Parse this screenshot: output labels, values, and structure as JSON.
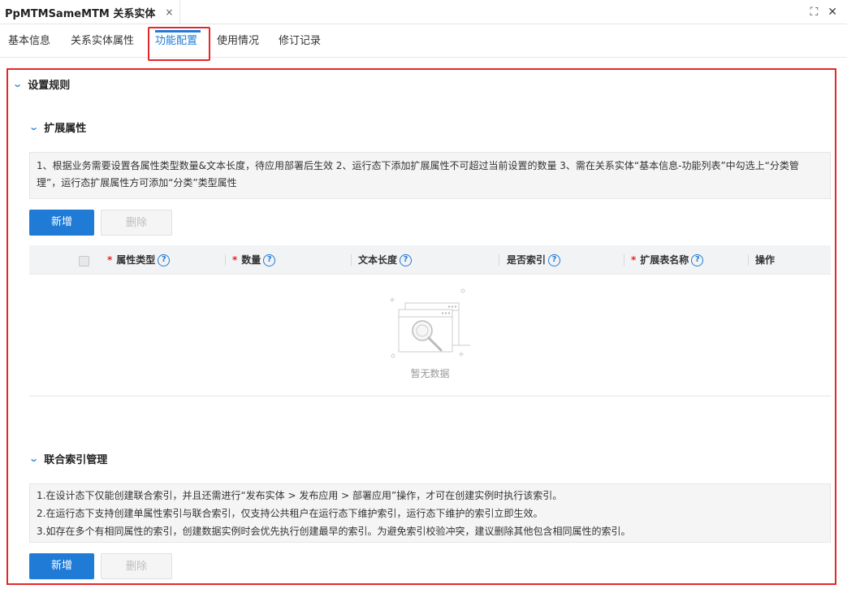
{
  "window": {
    "tab_title": "PpMTMSameMTM 关系实体",
    "close_glyph": "×",
    "expand_glyph": "⛶",
    "window_close_glyph": "✕"
  },
  "tabs": [
    {
      "label": "基本信息"
    },
    {
      "label": "关系实体属性"
    },
    {
      "label": "功能配置",
      "active": true
    },
    {
      "label": "使用情况"
    },
    {
      "label": "修订记录"
    }
  ],
  "settings": {
    "title": "设置规则",
    "extend": {
      "title": "扩展属性",
      "notice_line1": "1、根据业务需要设置各属性类型数量&文本长度，待应用部署后生效 2、运行态下添加扩展属性不可超过当前设置的数量 3、需在关系实体“基本信息-功能列表”中勾选上“分类管",
      "notice_line2": "理”，运行态扩展属性方可添加“分类”类型属性",
      "add_label": "新增",
      "delete_label": "删除",
      "columns": {
        "attr_type": "属性类型",
        "count": "数量",
        "text_length": "文本长度",
        "is_index": "是否索引",
        "ext_table": "扩展表名称",
        "actions": "操作"
      },
      "required_mark": "*",
      "help_glyph": "?",
      "empty_text": "暂无数据"
    },
    "joint_index": {
      "title": "联合索引管理",
      "notes": [
        "1.在设计态下仅能创建联合索引，并且还需进行“发布实体 > 发布应用 > 部署应用”操作，才可在创建实例时执行该索引。",
        "2.在运行态下支持创建单属性索引与联合索引，仅支持公共租户在运行态下维护索引，运行态下维护的索引立即生效。",
        "3.如存在多个有相同属性的索引，创建数据实例时会优先执行创建最早的索引。为避免索引校验冲突，建议删除其他包含相同属性的索引。"
      ],
      "add_label": "新增",
      "delete_label": "删除"
    }
  },
  "colors": {
    "accent": "#1f7bd6",
    "highlight": "#e5262a"
  }
}
